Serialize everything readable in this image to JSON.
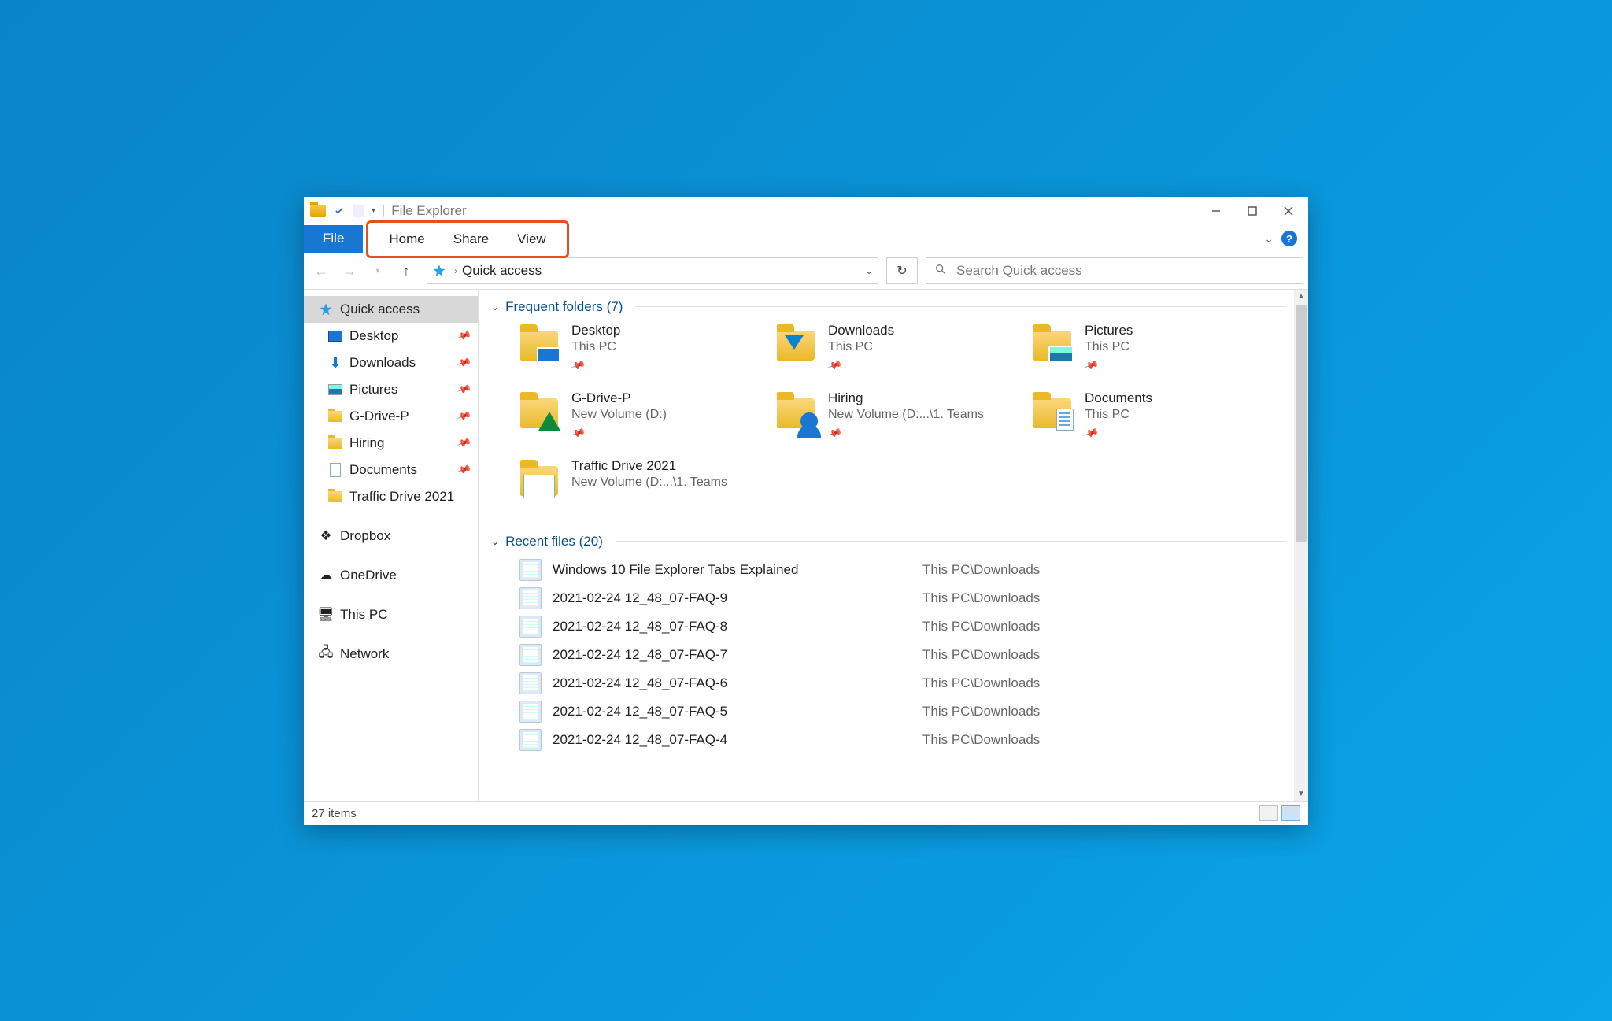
{
  "title": "File Explorer",
  "ribbon": {
    "file": "File",
    "tabs": [
      "Home",
      "Share",
      "View"
    ]
  },
  "address": {
    "location": "Quick access"
  },
  "search": {
    "placeholder": "Search Quick access"
  },
  "sidebar": {
    "quick_access": "Quick access",
    "pinned": [
      {
        "label": "Desktop",
        "icon": "desktop"
      },
      {
        "label": "Downloads",
        "icon": "download"
      },
      {
        "label": "Pictures",
        "icon": "picture"
      },
      {
        "label": "G-Drive-P",
        "icon": "folder"
      },
      {
        "label": "Hiring",
        "icon": "folder"
      },
      {
        "label": "Documents",
        "icon": "doc"
      }
    ],
    "unpinned_quick": "Traffic Drive 2021",
    "dropbox": "Dropbox",
    "onedrive": "OneDrive",
    "thispc": "This PC",
    "network": "Network"
  },
  "groups": {
    "frequent": {
      "label": "Frequent folders",
      "count": 7
    },
    "recent": {
      "label": "Recent files",
      "count": 20
    }
  },
  "frequent_folders": [
    {
      "name": "Desktop",
      "location": "This PC",
      "pinned": true,
      "icon": "desktop"
    },
    {
      "name": "Downloads",
      "location": "This PC",
      "pinned": true,
      "icon": "download"
    },
    {
      "name": "Pictures",
      "location": "This PC",
      "pinned": true,
      "icon": "picture"
    },
    {
      "name": "G-Drive-P",
      "location": "New Volume (D:)",
      "pinned": true,
      "icon": "gdrive"
    },
    {
      "name": "Hiring",
      "location": "New Volume (D:...\\1. Teams",
      "pinned": true,
      "icon": "user"
    },
    {
      "name": "Documents",
      "location": "This PC",
      "pinned": true,
      "icon": "doc"
    },
    {
      "name": "Traffic Drive 2021",
      "location": "New Volume (D:...\\1. Teams",
      "pinned": false,
      "icon": "traffic"
    }
  ],
  "recent_files": [
    {
      "name": "Windows 10 File Explorer Tabs Explained",
      "path": "This PC\\Downloads"
    },
    {
      "name": "2021-02-24 12_48_07-FAQ-9",
      "path": "This PC\\Downloads"
    },
    {
      "name": "2021-02-24 12_48_07-FAQ-8",
      "path": "This PC\\Downloads"
    },
    {
      "name": "2021-02-24 12_48_07-FAQ-7",
      "path": "This PC\\Downloads"
    },
    {
      "name": "2021-02-24 12_48_07-FAQ-6",
      "path": "This PC\\Downloads"
    },
    {
      "name": "2021-02-24 12_48_07-FAQ-5",
      "path": "This PC\\Downloads"
    },
    {
      "name": "2021-02-24 12_48_07-FAQ-4",
      "path": "This PC\\Downloads"
    }
  ],
  "statusbar": {
    "items": "27 items"
  }
}
